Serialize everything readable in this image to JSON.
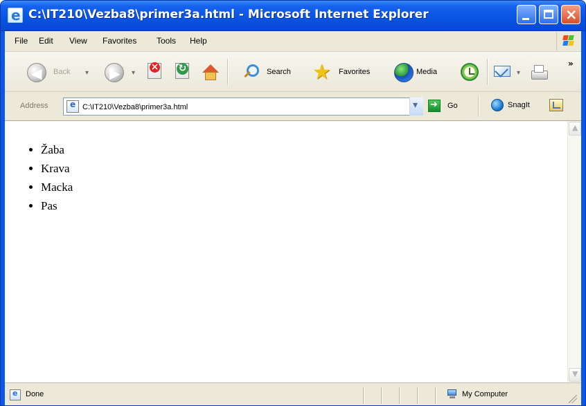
{
  "window": {
    "title": "C:\\IT210\\Vezba8\\primer3a.html - Microsoft Internet Explorer"
  },
  "menu": {
    "items": [
      "File",
      "Edit",
      "View",
      "Favorites",
      "Tools",
      "Help"
    ]
  },
  "toolbar": {
    "back_label": "Back",
    "search_label": "Search",
    "favorites_label": "Favorites",
    "media_label": "Media"
  },
  "address": {
    "label": "Address",
    "value": "C:\\IT210\\Vezba8\\primer3a.html",
    "go_label": "Go",
    "snagit_label": "SnagIt"
  },
  "page": {
    "animals": [
      "Žaba",
      "Krava",
      "Macka",
      "Pas"
    ]
  },
  "status": {
    "text": "Done",
    "zone": "My Computer"
  },
  "colors": {
    "title_bar": "#0a55e4",
    "chrome": "#ece9d8",
    "close_button": "#d84f2a",
    "windows_logo": [
      "#f14b1f",
      "#50bf2d",
      "#1d80f2",
      "#f7c318"
    ]
  },
  "icons": [
    "internet-explorer-icon",
    "minimize-icon",
    "maximize-icon",
    "close-icon",
    "windows-logo-icon",
    "back-icon",
    "forward-icon",
    "stop-icon",
    "refresh-icon",
    "home-icon",
    "search-icon",
    "favorites-icon",
    "media-icon",
    "history-icon",
    "mail-icon",
    "print-icon",
    "page-icon",
    "go-icon",
    "snagit-icon",
    "computer-icon"
  ]
}
